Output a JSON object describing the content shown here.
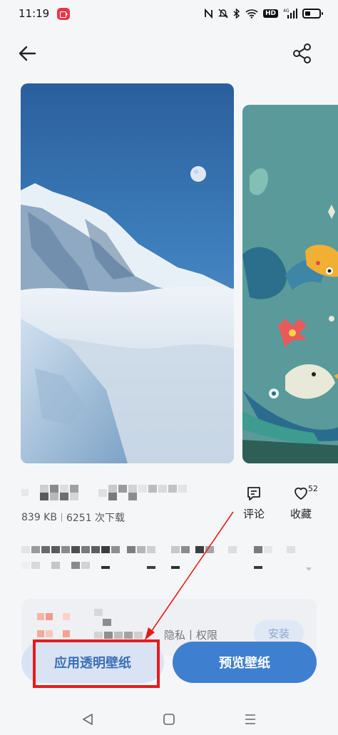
{
  "status_bar": {
    "time": "11:19",
    "icons": [
      "nfc-icon",
      "mute-icon",
      "bluetooth-icon",
      "wifi-icon",
      "hd-icon",
      "signal-4g-icon",
      "battery-icon"
    ],
    "hd_label": "HD",
    "network_label": "4G"
  },
  "header": {
    "back_icon": "back-arrow-icon",
    "share_icon": "share-icon"
  },
  "wallpaper": {
    "file_size": "839 KB",
    "downloads": "6251 次下载"
  },
  "actions": {
    "comment_label": "评论",
    "favorite_label": "收藏",
    "favorite_count": "52"
  },
  "app_card": {
    "privacy_text": "隐私丨权限",
    "install_label": "安装"
  },
  "buttons": {
    "apply_transparent_label": "应用透明壁纸",
    "preview_label": "预览壁纸"
  },
  "annotation": {
    "highlight_color": "#e51c1c"
  },
  "nav_bar": {
    "icons": [
      "back-triangle-icon",
      "home-square-icon",
      "menu-lines-icon"
    ]
  }
}
